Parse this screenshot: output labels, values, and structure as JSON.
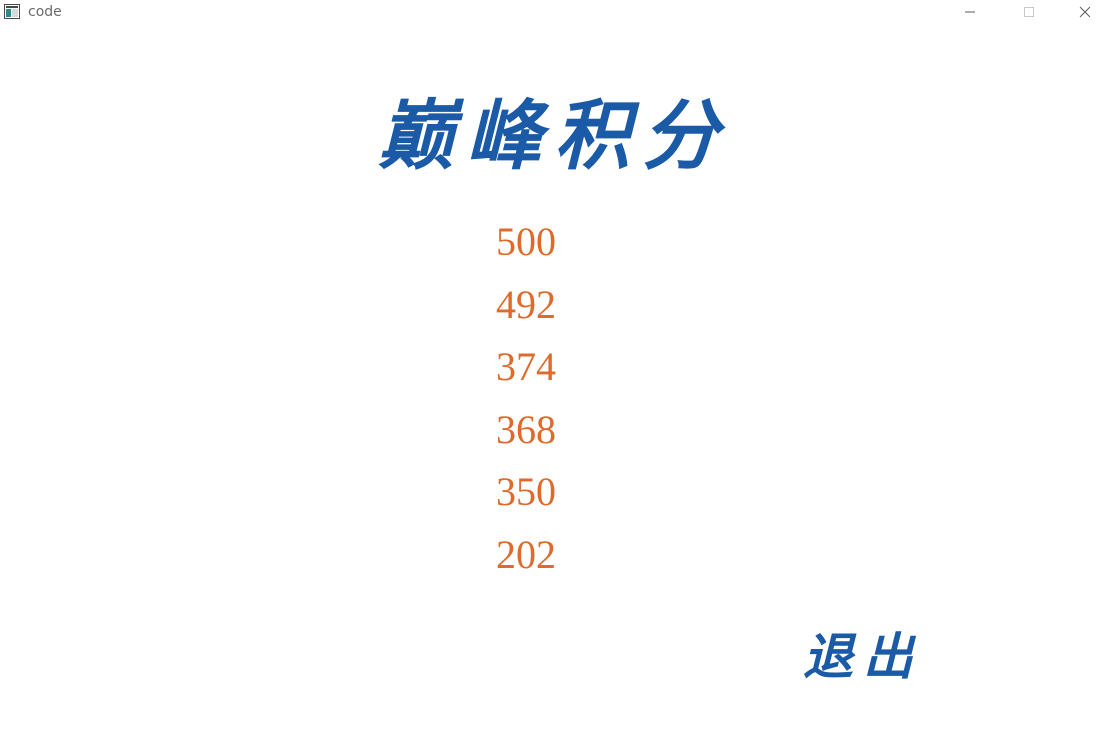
{
  "window": {
    "title": "code",
    "icon": "app-window-icon",
    "controls": {
      "minimize_icon": "minimize-icon",
      "maximize_icon": "maximize-icon",
      "close_icon": "close-icon"
    }
  },
  "heading": "巅峰积分",
  "scores": [
    "500",
    "492",
    "374",
    "368",
    "350",
    "202"
  ],
  "exit_label": "退出",
  "colors": {
    "heading": "#1a5aa6",
    "score": "#e06a2c",
    "background": "#ffffff"
  }
}
